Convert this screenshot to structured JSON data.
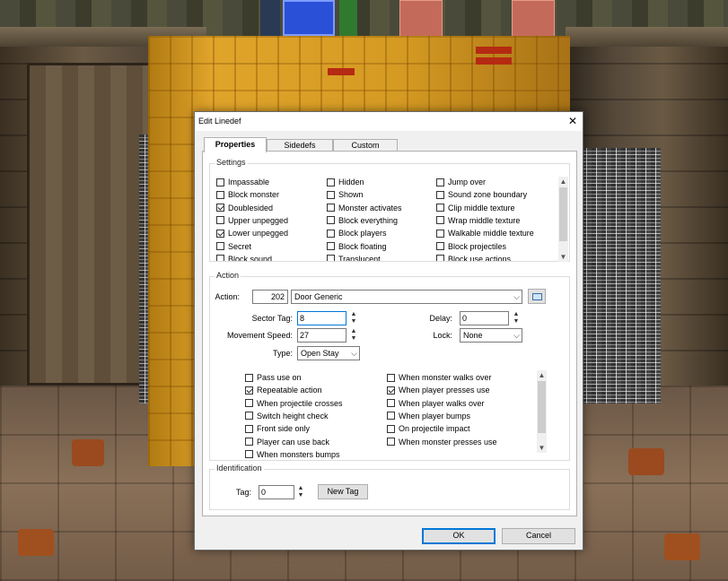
{
  "window": {
    "title": "Edit Linedef",
    "close_glyph": "✕"
  },
  "tabs": [
    {
      "label": "Properties",
      "active": true
    },
    {
      "label": "Sidedefs",
      "active": false
    },
    {
      "label": "Custom",
      "active": false
    }
  ],
  "settings": {
    "title": "Settings",
    "flags": [
      {
        "label": "Impassable",
        "checked": false
      },
      {
        "label": "Block monster",
        "checked": false
      },
      {
        "label": "Doublesided",
        "checked": true
      },
      {
        "label": "Upper unpegged",
        "checked": false
      },
      {
        "label": "Lower unpegged",
        "checked": true
      },
      {
        "label": "Secret",
        "checked": false
      },
      {
        "label": "Block sound",
        "checked": false
      },
      {
        "label": "Hidden",
        "checked": false
      },
      {
        "label": "Shown",
        "checked": false
      },
      {
        "label": "Monster activates",
        "checked": false
      },
      {
        "label": "Block everything",
        "checked": false
      },
      {
        "label": "Block players",
        "checked": false
      },
      {
        "label": "Block floating",
        "checked": false
      },
      {
        "label": "Translucent",
        "checked": false
      },
      {
        "label": "Jump over",
        "checked": false
      },
      {
        "label": "Sound zone boundary",
        "checked": false
      },
      {
        "label": "Clip middle texture",
        "checked": false
      },
      {
        "label": "Wrap middle texture",
        "checked": false
      },
      {
        "label": "Walkable middle texture",
        "checked": false
      },
      {
        "label": "Block projectiles",
        "checked": false
      },
      {
        "label": "Block use actions",
        "checked": false
      }
    ]
  },
  "action": {
    "title": "Action",
    "action_label": "Action:",
    "action_number": "202",
    "action_name": "Door Generic",
    "sector_tag_label": "Sector Tag:",
    "sector_tag": "8",
    "movement_speed_label": "Movement Speed:",
    "movement_speed": "27",
    "type_label": "Type:",
    "type_value": "Open Stay",
    "delay_label": "Delay:",
    "delay": "0",
    "lock_label": "Lock:",
    "lock_value": "None",
    "activations": [
      {
        "label": "Pass use on",
        "checked": false
      },
      {
        "label": "Repeatable action",
        "checked": true
      },
      {
        "label": "When projectile crosses",
        "checked": false
      },
      {
        "label": "Switch height check",
        "checked": false
      },
      {
        "label": "Front side only",
        "checked": false
      },
      {
        "label": "Player can use back",
        "checked": false
      },
      {
        "label": "When monsters bumps",
        "checked": false
      },
      {
        "label": "When monster walks over",
        "checked": false
      },
      {
        "label": "When player presses use",
        "checked": true
      },
      {
        "label": "When player walks over",
        "checked": false
      },
      {
        "label": "When player bumps",
        "checked": false
      },
      {
        "label": "On projectile impact",
        "checked": false
      },
      {
        "label": "When monster presses use",
        "checked": false
      }
    ]
  },
  "identification": {
    "title": "Identification",
    "tag_label": "Tag:",
    "tag": "0",
    "new_tag_label": "New Tag"
  },
  "footer": {
    "ok_label": "OK",
    "cancel_label": "Cancel"
  },
  "colors": {
    "accent": "#0078d7",
    "door": "#d49a22"
  }
}
